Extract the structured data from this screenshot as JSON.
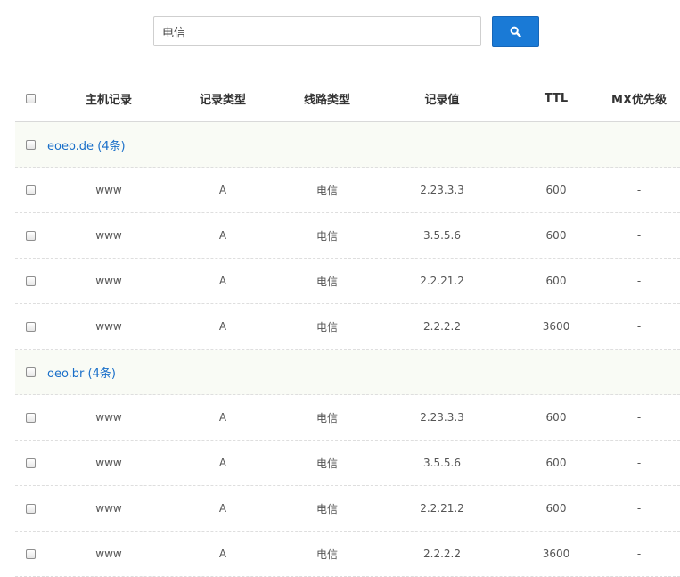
{
  "search": {
    "value": "电信",
    "icon": "search-icon"
  },
  "colors": {
    "accent": "#1a7ad6",
    "link": "#1a6fc9",
    "group_bg": "#f9fbf5"
  },
  "table": {
    "headers": [
      "主机记录",
      "记录类型",
      "线路类型",
      "记录值",
      "TTL",
      "MX优先级"
    ],
    "groups": [
      {
        "title": "eoeo.de (4条)",
        "rows": [
          [
            "www",
            "A",
            "电信",
            "2.23.3.3",
            "600",
            "-"
          ],
          [
            "www",
            "A",
            "电信",
            "3.5.5.6",
            "600",
            "-"
          ],
          [
            "www",
            "A",
            "电信",
            "2.2.21.2",
            "600",
            "-"
          ],
          [
            "www",
            "A",
            "电信",
            "2.2.2.2",
            "3600",
            "-"
          ]
        ]
      },
      {
        "title": "oeo.br (4条)",
        "rows": [
          [
            "www",
            "A",
            "电信",
            "2.23.3.3",
            "600",
            "-"
          ],
          [
            "www",
            "A",
            "电信",
            "3.5.5.6",
            "600",
            "-"
          ],
          [
            "www",
            "A",
            "电信",
            "2.2.21.2",
            "600",
            "-"
          ],
          [
            "www",
            "A",
            "电信",
            "2.2.2.2",
            "3600",
            "-"
          ]
        ]
      }
    ]
  }
}
